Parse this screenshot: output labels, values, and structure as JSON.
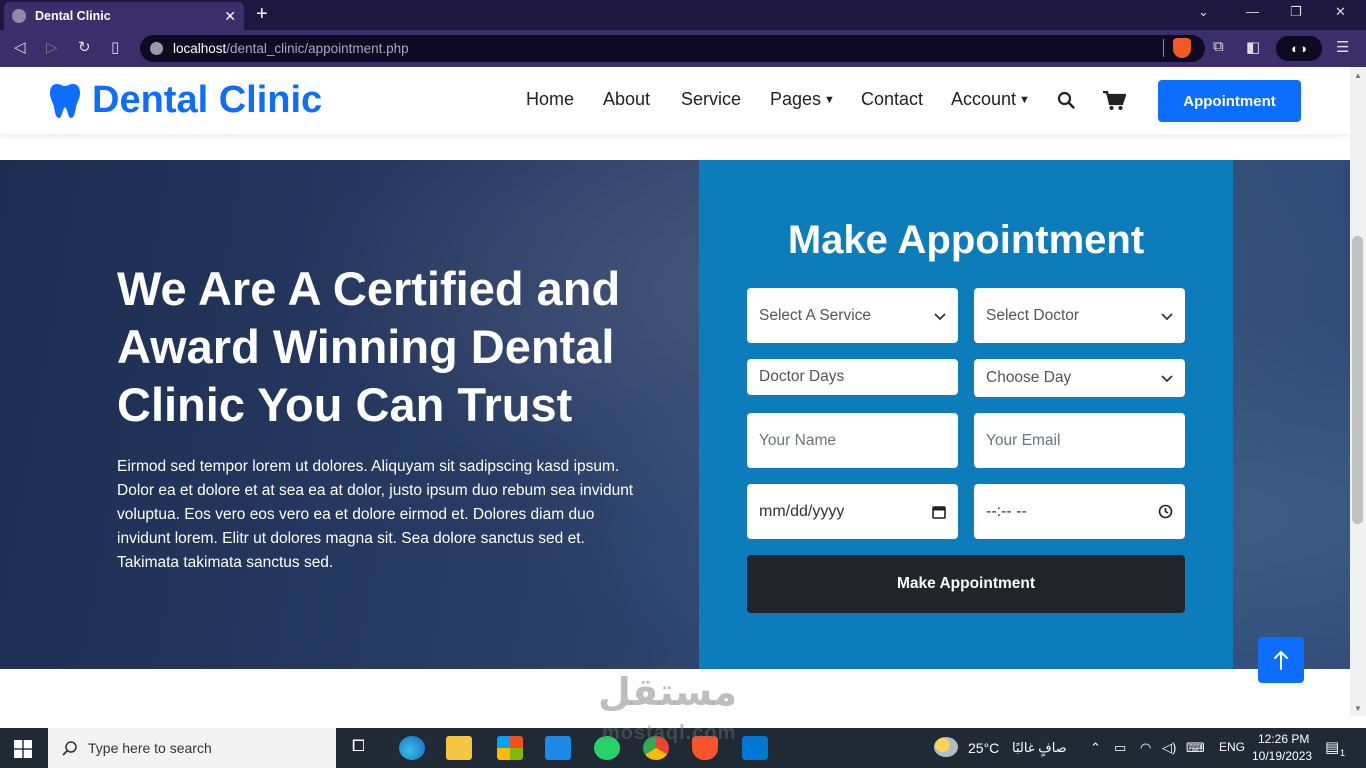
{
  "browser": {
    "tab_title": "Dental Clinic",
    "tab_close": "✕",
    "new_tab": "+",
    "url_host": "localhost",
    "url_path": "/dental_clinic/appointment.php"
  },
  "navbar": {
    "brand": "Dental Clinic",
    "items": [
      {
        "label": "Home"
      },
      {
        "label": "About"
      },
      {
        "label": "Service"
      },
      {
        "label": "Pages"
      },
      {
        "label": "Contact"
      },
      {
        "label": "Account"
      }
    ],
    "appointment_button": "Appointment"
  },
  "hero": {
    "title": "We Are A Certified and Award Winning Dental Clinic You Can Trust",
    "text": "Eirmod sed tempor lorem ut dolores. Aliquyam sit sadipscing kasd ipsum. Dolor ea et dolore et at sea ea at dolor, justo ipsum duo rebum sea invidunt voluptua. Eos vero eos vero ea et dolore eirmod et. Dolores diam duo invidunt lorem. Elitr ut dolores magna sit. Sea dolore sanctus sed et. Takimata takimata sanctus sed."
  },
  "appointment": {
    "title": "Make Appointment",
    "select_service": "Select A Service",
    "select_doctor": "Select Doctor",
    "doctor_days": "Doctor Days",
    "choose_day": "Choose Day",
    "name_placeholder": "Your Name",
    "email_placeholder": "Your Email",
    "date_placeholder": "mm/dd/yyyy",
    "time_placeholder": "--:-- --",
    "submit": "Make Appointment"
  },
  "watermark": {
    "arabic": "مستقل",
    "latin": "mostaql.com"
  },
  "taskbar": {
    "search_placeholder": "Type here to search",
    "weather_temp": "25°C",
    "weather_desc": "صافٍ غالبًا",
    "language": "ENG",
    "time": "12:26 PM",
    "date": "10/19/2023",
    "notification_count": "1"
  },
  "colors": {
    "primary": "#0d6efd",
    "appointment_panel": "#0d7cbb",
    "dark_button": "#212529",
    "browser_chrome": "#3a2f6b"
  }
}
